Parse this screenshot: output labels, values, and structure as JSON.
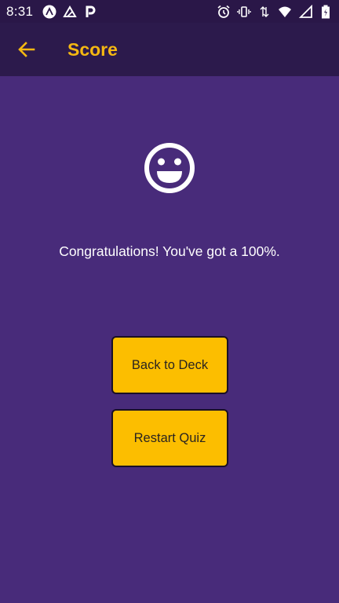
{
  "status_bar": {
    "time": "8:31",
    "left_icons": [
      "expo-icon",
      "app-icon",
      "parking-icon"
    ],
    "right_icons": [
      "alarm-icon",
      "vibrate-icon",
      "data-arrows-icon",
      "wifi-icon",
      "signal-icon",
      "battery-icon"
    ]
  },
  "app_bar": {
    "title": "Score",
    "back_icon": "arrow-left-icon",
    "accent_color": "#f5b812"
  },
  "main": {
    "result_icon": "smiley-icon",
    "message": "Congratulations! You've got a 100%.",
    "buttons": {
      "back_to_deck": "Back to Deck",
      "restart_quiz": "Restart Quiz"
    }
  },
  "colors": {
    "background": "#482b7a",
    "app_bar": "#2c1a4c",
    "button": "#fcbe00"
  }
}
